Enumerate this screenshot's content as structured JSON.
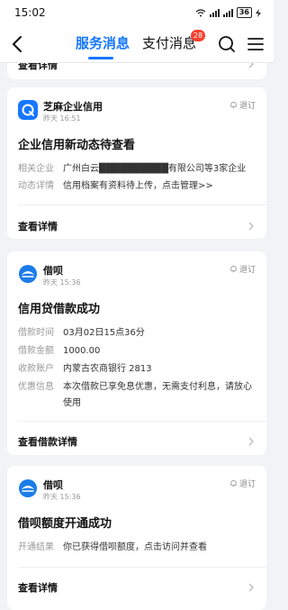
{
  "status_bar": {
    "time": "15:02",
    "battery": "36"
  },
  "header": {
    "tabs": [
      {
        "label": "服务消息",
        "active": true
      },
      {
        "label": "支付消息",
        "active": false,
        "badge": "28"
      }
    ]
  },
  "peek_card": {
    "footer": "查看详情"
  },
  "cards": [
    {
      "sender": "芝麻企业信用",
      "time": "昨天 16:51",
      "unsubscribe": "退订",
      "title": "企业信用新动态待查看",
      "rows": [
        {
          "k": "相关企业",
          "v": "广州白云██████████有限公司等3家企业"
        },
        {
          "k": "动态详情",
          "v": "信用档案有资料待上传，点击管理>>"
        }
      ],
      "footer": "查看详情"
    },
    {
      "sender": "借呗",
      "time": "昨天 15:36",
      "unsubscribe": "退订",
      "title": "信用贷借款成功",
      "rows": [
        {
          "k": "借款时间",
          "v": "03月02日15点36分"
        },
        {
          "k": "借款金额",
          "v": "1000.00"
        },
        {
          "k": "收款账户",
          "v": "内蒙古农商银行 2813"
        },
        {
          "k": "优惠信息",
          "v": "本次借款已享免息优惠，无需支付利息，请放心使用"
        }
      ],
      "footer": "查看借款详情"
    },
    {
      "sender": "借呗",
      "time": "昨天 15:36",
      "unsubscribe": "退订",
      "title": "借呗额度开通成功",
      "rows": [
        {
          "k": "开通结果",
          "v": "你已获得借呗额度，点击访问并查看"
        }
      ],
      "footer": "查看详情"
    }
  ],
  "colors": {
    "accent": "#1677ff",
    "badge": "#f5402c",
    "zhima": "#1677ff",
    "jiebei": "#1b7ce8"
  }
}
